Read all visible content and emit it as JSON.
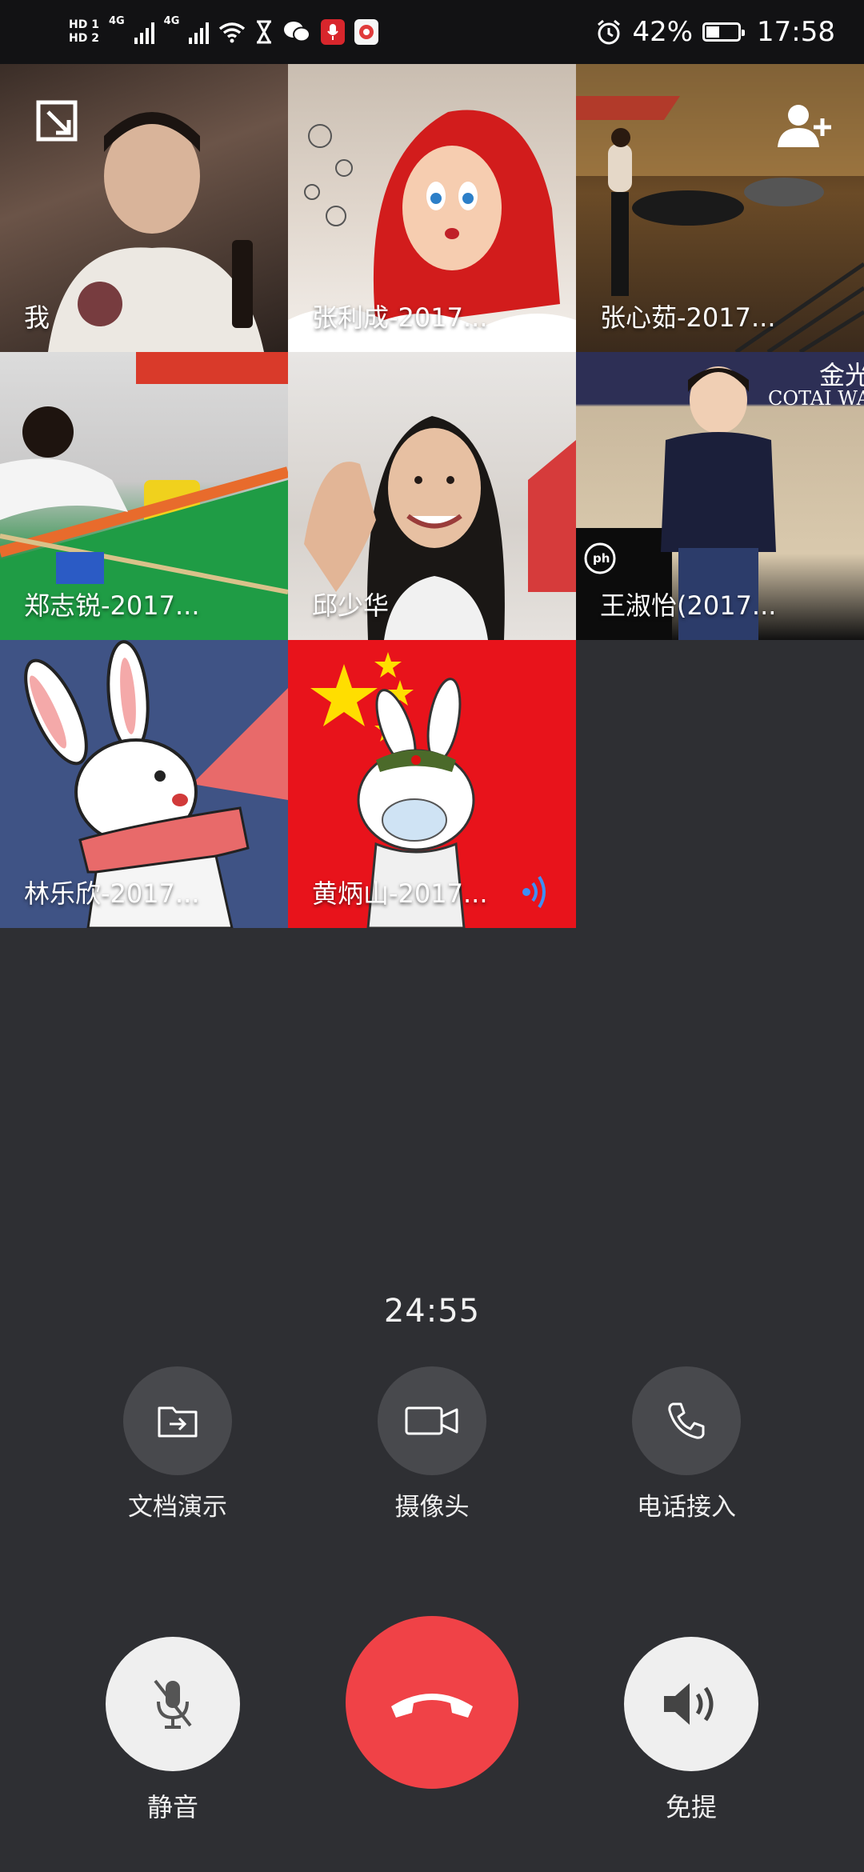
{
  "status_bar": {
    "hd1": "HD 1",
    "hd2": "HD 2",
    "net1": "4G",
    "net2": "4G",
    "battery": "42%",
    "battery_level": 0.42,
    "time": "17:58"
  },
  "participants": [
    {
      "name": "我"
    },
    {
      "name": "张利成-2017..."
    },
    {
      "name": "张心茹-2017..."
    },
    {
      "name": "郑志锐-2017..."
    },
    {
      "name": "邱少华"
    },
    {
      "name": "王淑怡(2017..."
    },
    {
      "name": "林乐欣-2017..."
    },
    {
      "name": "黄炳山-2017..."
    }
  ],
  "tile_text": {
    "sign_top": "金光",
    "sign_sub": "COTAI WA",
    "ph_badge": "ph"
  },
  "call": {
    "duration": "24:55"
  },
  "features": {
    "doc_share": "文档演示",
    "camera": "摄像头",
    "phone_in": "电话接入"
  },
  "controls": {
    "mute": "静音",
    "speaker": "免提"
  },
  "colors": {
    "hangup": "#f04247",
    "speaking_indicator": "#3d8ff5"
  }
}
